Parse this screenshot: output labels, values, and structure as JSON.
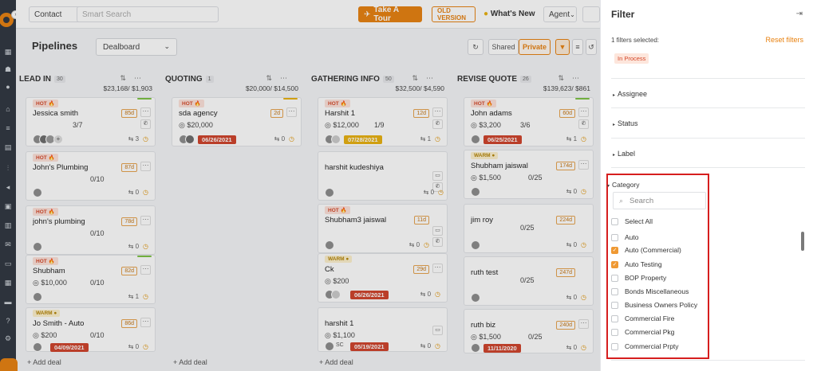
{
  "topbar": {
    "contact_select": "Contact",
    "search_placeholder": "Smart Search",
    "tour_label": "Take A Tour",
    "old_version_label": "OLD VERSION",
    "whats_new_label": "What's New",
    "agent_label": "Agent"
  },
  "toolbar": {
    "title": "Pipelines",
    "view_select": "Dealboard",
    "shared_label": "Shared",
    "private_label": "Private"
  },
  "columns": [
    {
      "name": "LEAD IN",
      "count": "30",
      "amount": "$23,168/ $1,903",
      "add_label": "Add deal"
    },
    {
      "name": "QUOTING",
      "count": "1",
      "amount": "$20,000/ $14,500",
      "add_label": "Add deal"
    },
    {
      "name": "GATHERING INFO",
      "count": "50",
      "amount": "$32,500/ $4,590",
      "add_label": "Add deal"
    },
    {
      "name": "REVISE QUOTE",
      "count": "26",
      "amount": "$139,623/ $861",
      "add_label": "Add deal"
    }
  ],
  "cards": {
    "c0": [
      {
        "tag": "HOT",
        "name": "Jessica smith",
        "days": "85d",
        "progress": "3/7",
        "count": "3"
      },
      {
        "tag": "HOT",
        "name": "John's Plumbing",
        "days": "87d",
        "progress": "0/10",
        "count": "0"
      },
      {
        "tag": "HOT",
        "name": "john's plumbing",
        "days": "78d",
        "progress": "0/10",
        "count": "0"
      },
      {
        "tag": "HOT",
        "name": "Shubham",
        "days": "82d",
        "value": "$10,000",
        "progress": "0/10",
        "count": "1"
      },
      {
        "tag": "WARM",
        "name": "Jo Smith - Auto",
        "days": "86d",
        "value": "$200",
        "progress": "0/10",
        "date": "04/09/2021",
        "count": "0"
      }
    ],
    "c1": [
      {
        "tag": "HOT",
        "name": "sda agency",
        "days": "2d",
        "value": "$20,000",
        "date": "06/26/2021",
        "count": "0"
      }
    ],
    "c2": [
      {
        "tag": "HOT",
        "name": "Harshit 1",
        "days": "12d",
        "value": "$12,000",
        "progress": "1/9",
        "date": "07/28/2021",
        "count": "1"
      },
      {
        "tag": "",
        "name": "harshit kudeshiya",
        "count": "0"
      },
      {
        "tag": "HOT",
        "name": "Shubham3 jaiswal",
        "days": "11d",
        "count": "0"
      },
      {
        "tag": "WARM",
        "name": "Ck",
        "days": "29d",
        "value": "$200",
        "date": "06/26/2021",
        "count": "0"
      },
      {
        "tag": "",
        "name": "harshit 1",
        "value": "$1,100",
        "date": "05/19/2021",
        "avatar_text": "SC",
        "count": "0"
      }
    ],
    "c3": [
      {
        "tag": "HOT",
        "name": "John adams",
        "days": "60d",
        "value": "$3,200",
        "progress": "3/6",
        "date": "06/25/2021",
        "count": "1"
      },
      {
        "tag": "WARM",
        "name": "Shubham jaiswal",
        "days": "174d",
        "value": "$1,500",
        "progress": "0/25",
        "count": "0"
      },
      {
        "tag": "",
        "name": "jim roy",
        "days": "224d",
        "progress": "0/25",
        "count": "0"
      },
      {
        "tag": "",
        "name": "ruth test",
        "days": "247d",
        "progress": "0/25",
        "count": "0"
      },
      {
        "tag": "",
        "name": "ruth biz",
        "days": "240d",
        "value": "$1,500",
        "progress": "0/25",
        "date": "11/11/2020",
        "count": "0"
      }
    ]
  },
  "filter": {
    "title": "Filter",
    "selected_info": "1 filters selected:",
    "reset_label": "Reset filters",
    "chip": "In Process",
    "sections": [
      "Assignee",
      "Status",
      "Label"
    ],
    "category_title": "Category",
    "category_search_placeholder": "Search",
    "options": [
      {
        "label": "Select All",
        "checked": false
      },
      {
        "label": "Auto",
        "checked": false
      },
      {
        "label": "Auto (Commercial)",
        "checked": true
      },
      {
        "label": "Auto Testing",
        "checked": true
      },
      {
        "label": "BOP Property",
        "checked": false
      },
      {
        "label": "Bonds Miscellaneous",
        "checked": false
      },
      {
        "label": "Business Owners Policy",
        "checked": false
      },
      {
        "label": "Commercial Fire",
        "checked": false
      },
      {
        "label": "Commercial Pkg",
        "checked": false
      },
      {
        "label": "Commercial Prpty",
        "checked": false
      }
    ]
  },
  "colors": {
    "accent": "#e8810f",
    "hot_bg": "#fde2da",
    "warm_bg": "#fdf1cc",
    "date_red": "#d0432b",
    "date_yellow": "#e9b10f",
    "highlight": "#d61e1e"
  }
}
